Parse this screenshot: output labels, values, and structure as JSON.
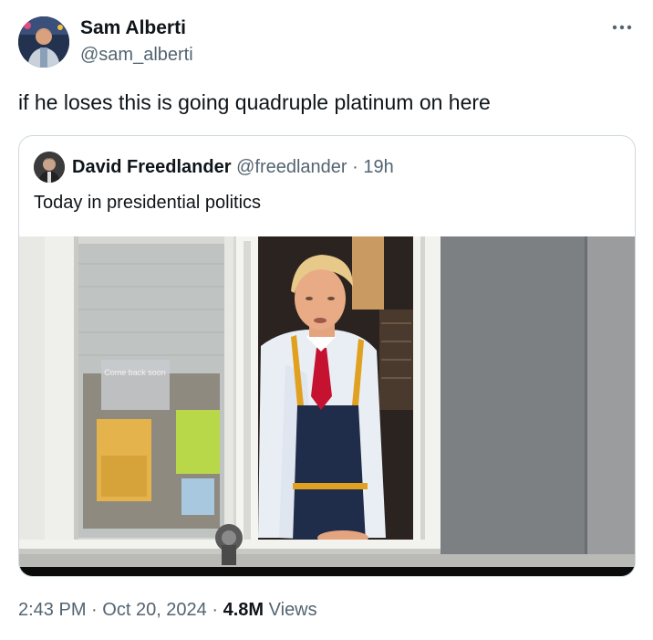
{
  "tweet": {
    "author_name": "Sam Alberti",
    "author_handle": "@sam_alberti",
    "text": "if he loses this is going quadruple platinum on here",
    "more_icon": "more-horizontal-icon"
  },
  "quote": {
    "author_name": "David Freedlander",
    "author_handle": "@freedlander",
    "separator": "·",
    "time": "19h",
    "text": "Today in presidential politics",
    "sign_text": "Come back soon"
  },
  "meta": {
    "time": "2:43 PM",
    "separator": "·",
    "date": "Oct 20, 2024",
    "separator2": "·",
    "views_count": "4.8M",
    "views_label": "Views"
  }
}
